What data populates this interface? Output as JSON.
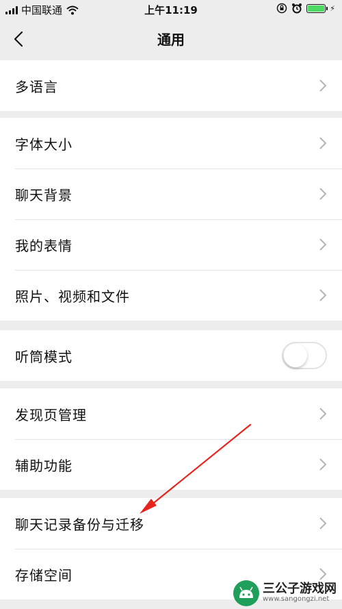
{
  "status_bar": {
    "carrier": "中国联通",
    "time": "上午11:19",
    "battery_level": 1.0
  },
  "nav": {
    "title": "通用",
    "back_icon": "chevron-left-icon"
  },
  "groups": [
    {
      "items": [
        {
          "label": "多语言"
        }
      ]
    },
    {
      "items": [
        {
          "label": "字体大小"
        },
        {
          "label": "聊天背景"
        },
        {
          "label": "我的表情"
        },
        {
          "label": "照片、视频和文件"
        }
      ]
    },
    {
      "items": [
        {
          "label": "听筒模式",
          "toggle_on": false
        }
      ]
    },
    {
      "items": [
        {
          "label": "发现页管理"
        },
        {
          "label": "辅助功能"
        }
      ]
    },
    {
      "items": [
        {
          "label": "聊天记录备份与迁移"
        },
        {
          "label": "存储空间"
        }
      ]
    }
  ],
  "annotation": {
    "type": "red-arrow-icon",
    "color": "#e8231b",
    "points_to": "聊天记录备份与迁移"
  },
  "watermark": {
    "name": "三公子游戏网",
    "url": "www.sangongzi.net"
  },
  "colors": {
    "background": "#ededed",
    "toggle_knob": "#ffffff",
    "arrow": "#e8231b",
    "battery": "#4cd964"
  }
}
